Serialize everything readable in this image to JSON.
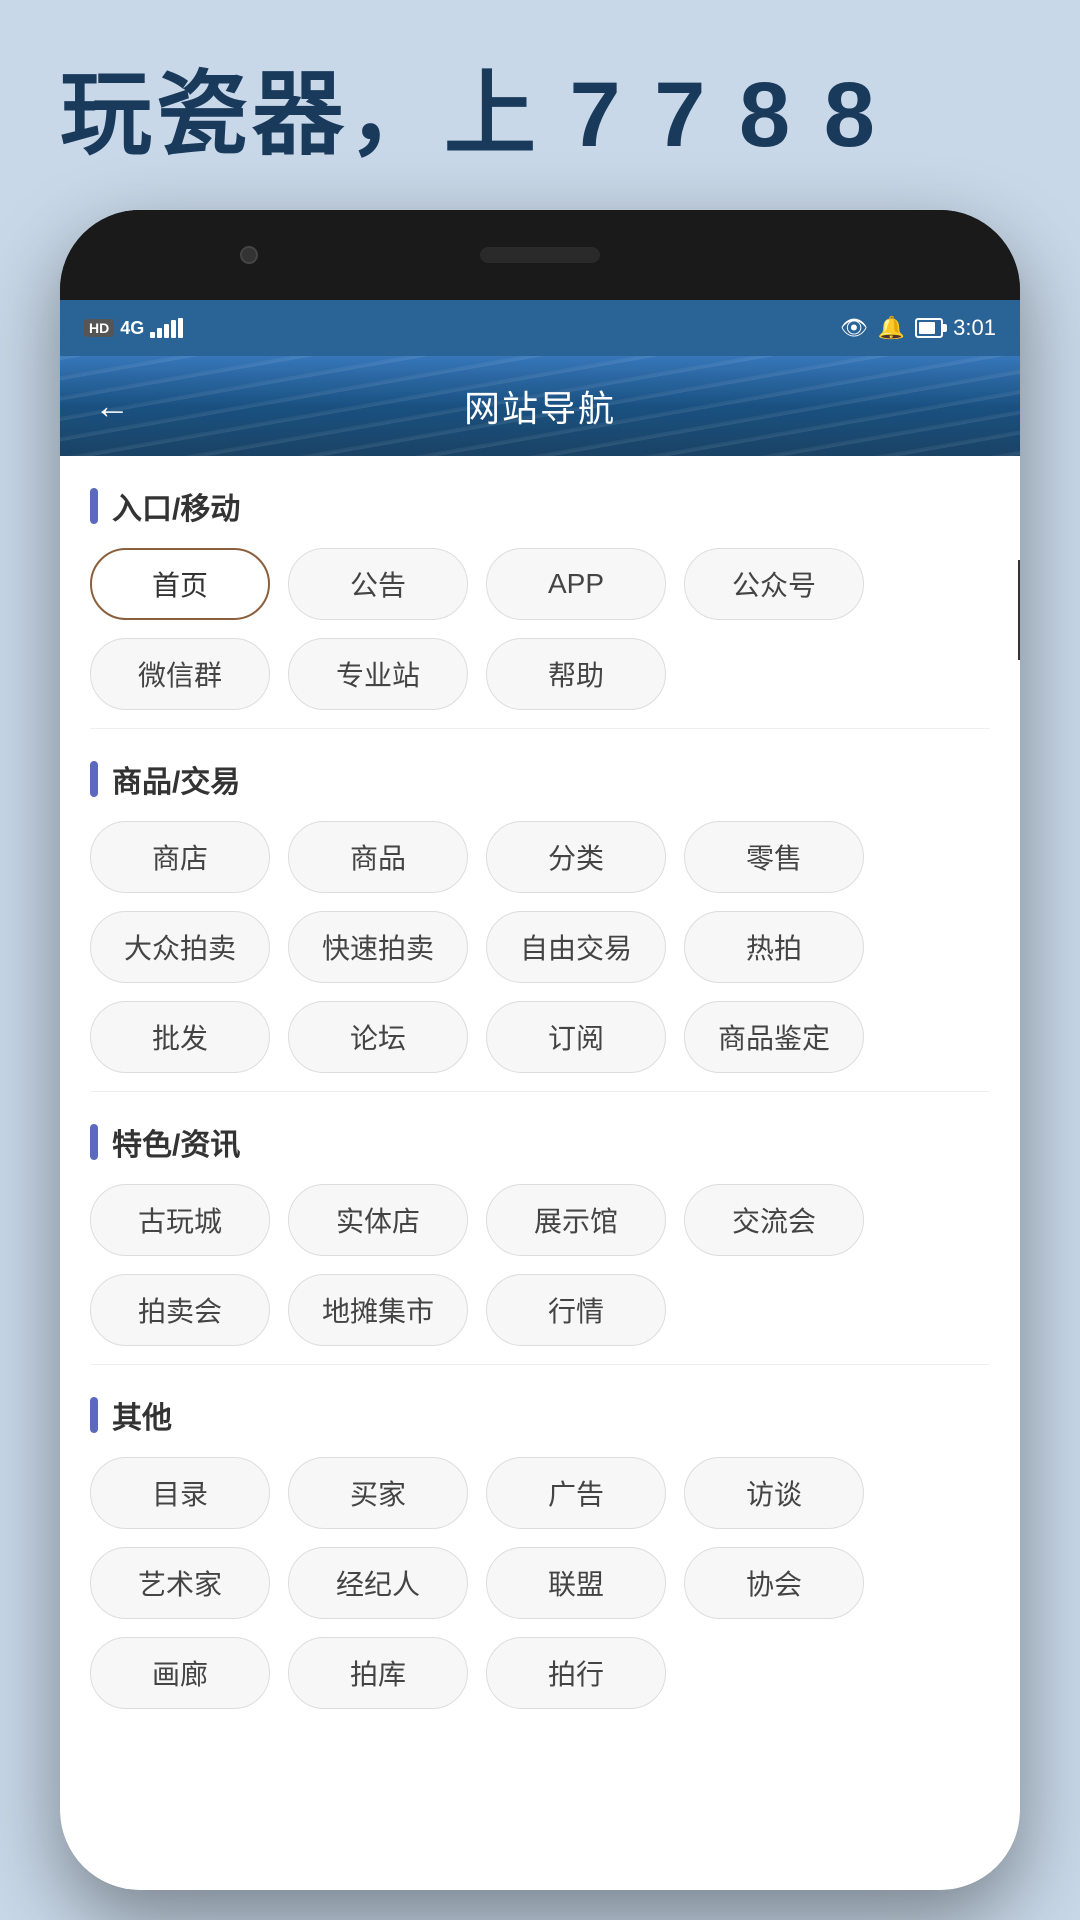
{
  "tagline": "玩瓷器，上 7 7 8 8",
  "statusBar": {
    "time": "3:01",
    "hd": "HD",
    "fourG": "4G"
  },
  "header": {
    "title": "网站导航",
    "backLabel": "←"
  },
  "sections": [
    {
      "id": "section-entry",
      "title": "入口/移动",
      "buttons": [
        {
          "label": "首页",
          "active": true
        },
        {
          "label": "公告",
          "active": false
        },
        {
          "label": "APP",
          "active": false
        },
        {
          "label": "公众号",
          "active": false
        },
        {
          "label": "微信群",
          "active": false
        },
        {
          "label": "专业站",
          "active": false
        },
        {
          "label": "帮助",
          "active": false
        }
      ]
    },
    {
      "id": "section-goods",
      "title": "商品/交易",
      "buttons": [
        {
          "label": "商店",
          "active": false
        },
        {
          "label": "商品",
          "active": false
        },
        {
          "label": "分类",
          "active": false
        },
        {
          "label": "零售",
          "active": false
        },
        {
          "label": "大众拍卖",
          "active": false
        },
        {
          "label": "快速拍卖",
          "active": false
        },
        {
          "label": "自由交易",
          "active": false
        },
        {
          "label": "热拍",
          "active": false
        },
        {
          "label": "批发",
          "active": false
        },
        {
          "label": "论坛",
          "active": false
        },
        {
          "label": "订阅",
          "active": false
        },
        {
          "label": "商品鉴定",
          "active": false
        }
      ]
    },
    {
      "id": "section-features",
      "title": "特色/资讯",
      "buttons": [
        {
          "label": "古玩城",
          "active": false
        },
        {
          "label": "实体店",
          "active": false
        },
        {
          "label": "展示馆",
          "active": false
        },
        {
          "label": "交流会",
          "active": false
        },
        {
          "label": "拍卖会",
          "active": false
        },
        {
          "label": "地摊集市",
          "active": false
        },
        {
          "label": "行情",
          "active": false
        }
      ]
    },
    {
      "id": "section-other",
      "title": "其他",
      "buttons": [
        {
          "label": "目录",
          "active": false
        },
        {
          "label": "买家",
          "active": false
        },
        {
          "label": "广告",
          "active": false
        },
        {
          "label": "访谈",
          "active": false
        },
        {
          "label": "艺术家",
          "active": false
        },
        {
          "label": "经纪人",
          "active": false
        },
        {
          "label": "联盟",
          "active": false
        },
        {
          "label": "协会",
          "active": false
        },
        {
          "label": "画廊",
          "active": false
        },
        {
          "label": "拍库",
          "active": false
        },
        {
          "label": "拍行",
          "active": false
        }
      ]
    }
  ]
}
